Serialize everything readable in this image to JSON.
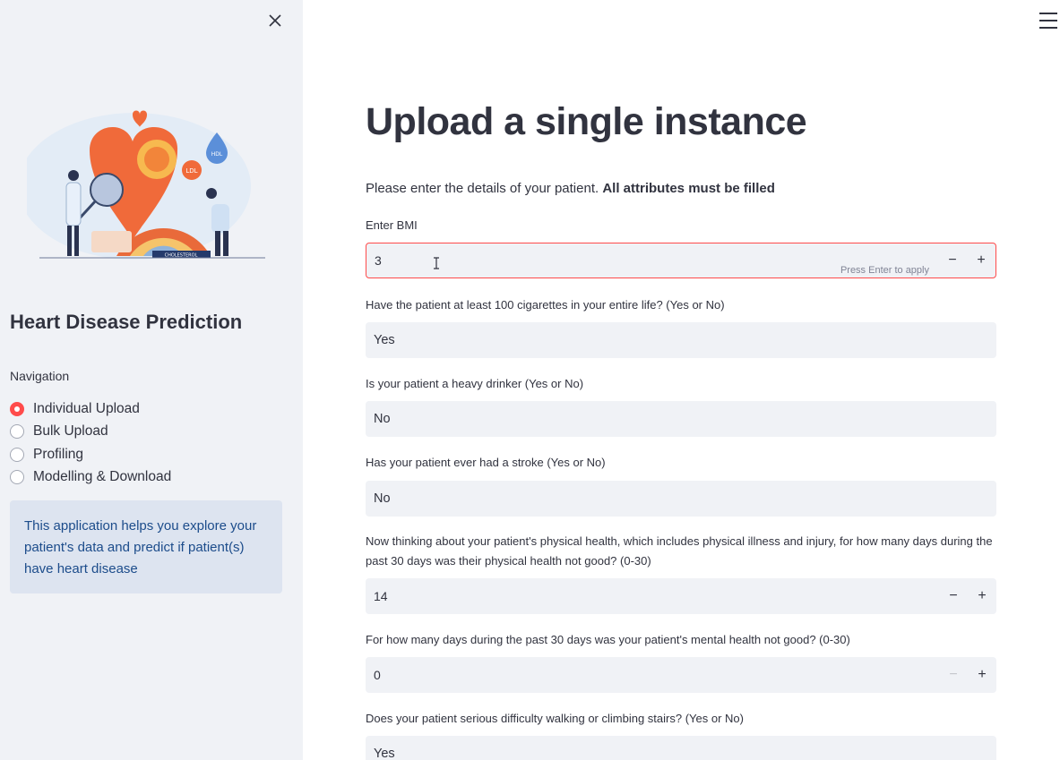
{
  "sidebar": {
    "close_label": "×",
    "title": "Heart Disease Prediction",
    "nav_label": "Navigation",
    "nav_items": [
      {
        "label": "Individual Upload",
        "selected": true
      },
      {
        "label": "Bulk Upload",
        "selected": false
      },
      {
        "label": "Profiling",
        "selected": false
      },
      {
        "label": "Modelling & Download",
        "selected": false
      }
    ],
    "info": "This application helps you explore your patient's data and predict if patient(s) have heart disease",
    "illustration": {
      "labels": [
        "HDL",
        "LDL",
        "CHOLESTEROL"
      ]
    }
  },
  "main": {
    "title": "Upload a single instance",
    "intro_text": "Please enter the details of your patient. ",
    "intro_bold": "All attributes must be filled",
    "bmi": {
      "label": "Enter BMI",
      "value": "3",
      "hint": "Press Enter to apply"
    },
    "smoking": {
      "label": "Have the patient at least 100 cigarettes in your entire life? (Yes or No)",
      "value": "Yes"
    },
    "drinker": {
      "label": "Is your patient a heavy drinker (Yes or No)",
      "value": "No"
    },
    "stroke": {
      "label": "Has your patient ever had a stroke (Yes or No)",
      "value": "No"
    },
    "physical": {
      "label": "Now thinking about your patient's physical health, which includes physical illness and injury, for how many days during the past 30 days was their physical health not good? (0-30)",
      "value": "14"
    },
    "mental": {
      "label": "For how many days during the past 30 days was your patient's mental health not good? (0-30)",
      "value": "0"
    },
    "walking": {
      "label": "Does your patient serious difficulty walking or climbing stairs? (Yes or No)",
      "value": "Yes"
    }
  },
  "colors": {
    "accent": "#ff4b4b",
    "sidebar_bg": "#f0f2f6",
    "info_bg": "#dde4f0",
    "info_text": "#1c4c8b"
  },
  "icons": [
    "close-icon",
    "hamburger-menu-icon",
    "minus-icon",
    "plus-icon",
    "text-cursor-icon"
  ]
}
